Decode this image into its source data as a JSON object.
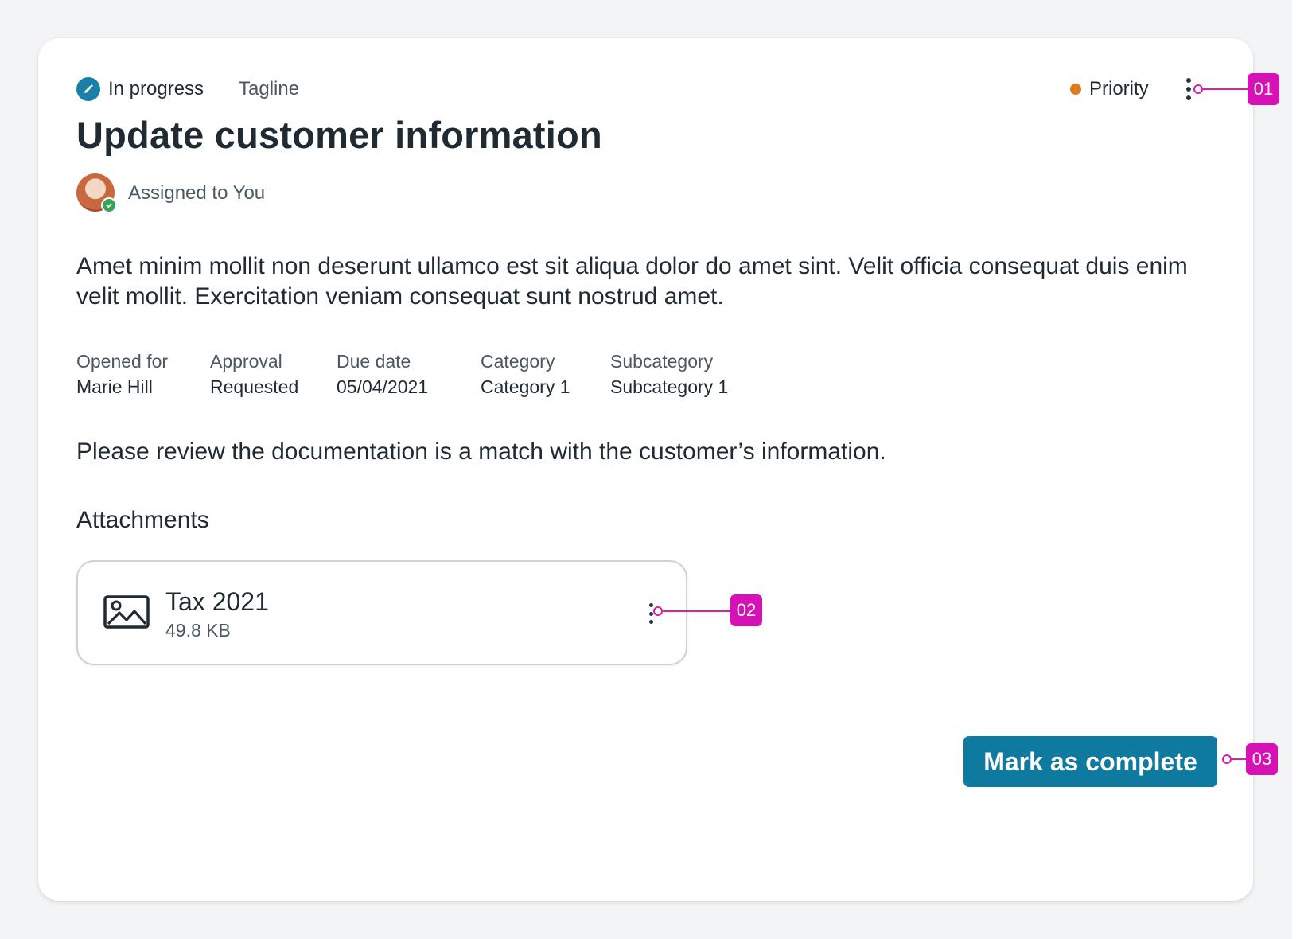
{
  "task": {
    "status": "In progress",
    "tagline": "Tagline",
    "priority": "Priority",
    "title": "Update customer information",
    "assignee": "Assigned to You",
    "description": "Amet minim mollit non deserunt ullamco est sit aliqua dolor do amet sint. Velit officia consequat duis enim velit mollit. Exercitation veniam consequat sunt nostrud amet.",
    "fields": [
      {
        "label": "Opened for",
        "value": "Marie Hill"
      },
      {
        "label": "Approval",
        "value": "Requested"
      },
      {
        "label": "Due date",
        "value": "05/04/2021"
      },
      {
        "label": "Category",
        "value": "Category 1"
      },
      {
        "label": "Subcategory",
        "value": "Subcategory 1"
      }
    ],
    "note": "Please review the documentation is a match with the customer’s information."
  },
  "attachments": {
    "heading": "Attachments",
    "items": [
      {
        "name": "Tax 2021",
        "size": "49.8 KB",
        "icon": "image-icon"
      }
    ]
  },
  "actions": {
    "complete_label": "Mark as complete"
  },
  "callouts": [
    "01",
    "02",
    "03"
  ],
  "colors": {
    "accent": "#0f7a9f",
    "status_icon": "#1c80a6",
    "priority_dot": "#e07a1c",
    "callout": "#d611b5",
    "presence": "#3aa35a"
  }
}
